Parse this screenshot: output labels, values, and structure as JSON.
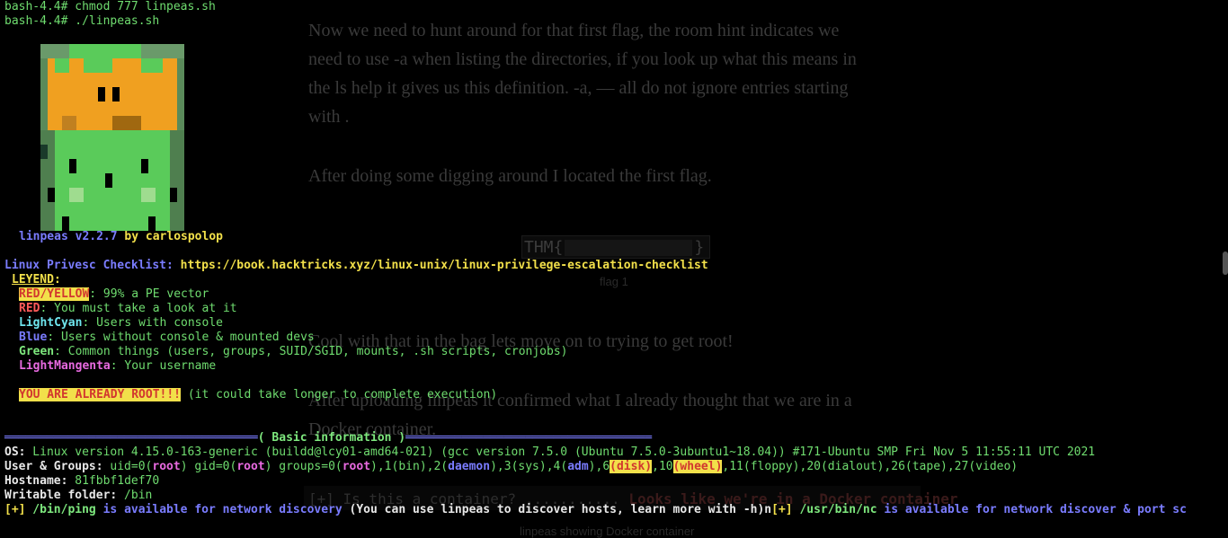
{
  "background_article": {
    "para1": [
      "Now we need to hunt around for that first flag, the room hint indicates we",
      "need to use -a when listing the directories, if you look up what this means in",
      "the ls help it gives us this definition. -a, — all do not ignore entries starting",
      "with ."
    ],
    "para2": "After doing some digging around I located the first flag.",
    "flag_prefix": "THM{",
    "flag_suffix": "}",
    "flag_caption": "flag 1",
    "para3": "Cool with that in the bag lets move on to trying to get root!",
    "para4": [
      "After uploading linpeas it confirmed what I already thought that we are in a",
      "Docker container."
    ],
    "container_prefix": "[+] Is this a container? ...........",
    "container_result": "Looks like we're in a Docker container",
    "container_caption": "linpeas showing Docker container"
  },
  "terminal": {
    "cmd1_prompt": "bash-4.4#",
    "cmd1": " chmod 777 linpeas.sh",
    "cmd2_prompt": "bash-4.4#",
    "cmd2": " ./linpeas.sh",
    "version": "linpeas v2.2.7",
    "by": " by carlospolop",
    "checklist_label": "Linux Privesc Checklist:",
    "checklist_url": " https://book.hacktricks.xyz/linux-unix/linux-privilege-escalation-checklist",
    "legend_title": "LEYEND",
    "legend_colon": ":",
    "legend": {
      "ry": "RED/YELLOW",
      "ry_desc": ": 99% a PE vector",
      "red": "RED",
      "red_desc": ": You must take a look at it",
      "cyan": "LightCyan",
      "cyan_desc": ": Users with console",
      "blue": "Blue",
      "blue_desc": ": Users without console & mounted devs",
      "green": "Green",
      "green_desc": ": Common things (users, groups, SUID/SGID, mounts, .sh scripts, cronjobs)",
      "magenta": "LightMangenta",
      "magenta_desc": ": Your username"
    },
    "root_warning": "YOU ARE ALREADY ROOT!!!",
    "root_note": " (it could take longer to complete execution)",
    "section_rule_left": "════════════════════════════════════",
    "section_title": "( Basic information )",
    "section_rule_right": "═══════════════════════════════════",
    "os_label": "OS:",
    "os_value": " Linux version 4.15.0-163-generic (buildd@lcy01-amd64-021) (gcc version 7.5.0 (Ubuntu 7.5.0-3ubuntu1~18.04)) #171-Ubuntu SMP Fri Nov 5 11:55:11 UTC 2021",
    "ug_label": "User & Groups:",
    "ug": {
      "p1": " uid=0(",
      "root1": "root",
      "p2": ") gid=0(",
      "root2": "root",
      "p3": ") groups=0(",
      "root3": "root",
      "p4": "),1(bin),2(",
      "daemon": "daemon",
      "p5": "),3(sys),4(",
      "adm": "adm",
      "p6": "),6",
      "disk": "(disk)",
      "p7": ",10",
      "wheel": "(wheel)",
      "p8": ",11(floppy),20(dialout),26(tape),27(video)"
    },
    "hostname_label": "Hostname:",
    "hostname_value": " 81fbbf1def70",
    "writable_label": "Writable folder:",
    "writable_value": " /bin",
    "last": {
      "a": "[+]",
      "b": " /bin/ping",
      "c": " is available for network discovery",
      "d": " (You can use linpeas to discover hosts, learn more with -h)n",
      "e": "[+]",
      "f": " /usr/bin/nc",
      "g": " is available for network discover & port sc"
    }
  },
  "colors": {
    "green": "#6fdc6f",
    "yellow": "#f2e04a",
    "blue": "#7a7cff",
    "magenta": "#e86ae0",
    "red": "#ff5a5a",
    "cyan": "#6fe6ee"
  }
}
